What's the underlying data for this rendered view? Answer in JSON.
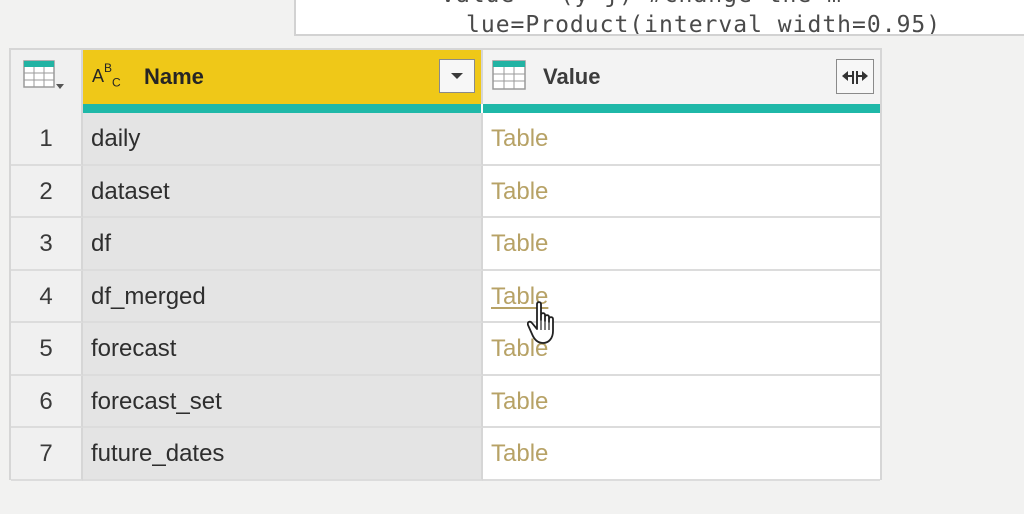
{
  "code_editor": {
    "line1": "value = (y j) #change the m",
    "line2": "lue=Product(interval width=0.95)"
  },
  "table": {
    "columns": [
      {
        "label": "Name",
        "type": "text",
        "type_icon_text": "ABC"
      },
      {
        "label": "Value",
        "type": "table"
      }
    ],
    "rows": [
      {
        "index": "1",
        "name": "daily",
        "value": "Table"
      },
      {
        "index": "2",
        "name": "dataset",
        "value": "Table"
      },
      {
        "index": "3",
        "name": "df",
        "value": "Table"
      },
      {
        "index": "4",
        "name": "df_merged",
        "value": "Table"
      },
      {
        "index": "5",
        "name": "forecast",
        "value": "Table"
      },
      {
        "index": "6",
        "name": "forecast_set",
        "value": "Table"
      },
      {
        "index": "7",
        "name": "future_dates",
        "value": "Table"
      }
    ],
    "hovered_row": 4
  },
  "colors": {
    "selected_header": "#efc818",
    "quality_bar": "#1fb8a8",
    "table_link": "#b7a266"
  },
  "icons": {
    "corner": "table-menu-icon",
    "name_type": "abc-text-type-icon",
    "value_type": "table-type-icon",
    "name_filter": "chevron-down-icon",
    "value_expand": "expand-columns-icon",
    "cursor": "hand-pointer-icon"
  }
}
